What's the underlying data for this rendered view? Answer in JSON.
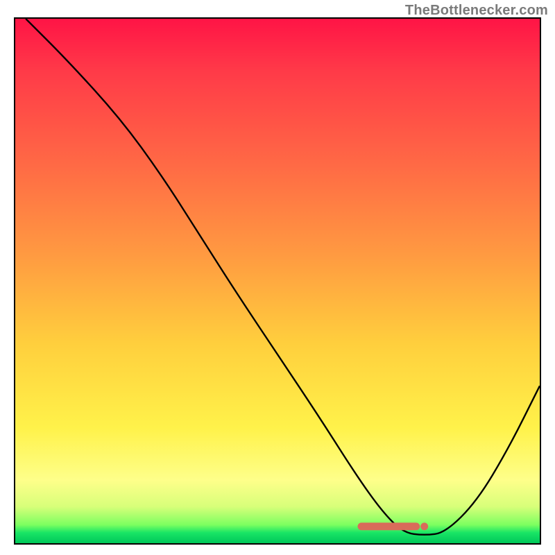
{
  "attribution": "TheBottlenecker.com",
  "chart_data": {
    "type": "line",
    "title": "",
    "xlabel": "",
    "ylabel": "",
    "xlim": [
      0,
      100
    ],
    "ylim": [
      0,
      100
    ],
    "x": [
      2,
      10,
      20,
      28,
      35,
      42,
      50,
      58,
      65,
      70,
      74,
      78,
      82,
      88,
      94,
      100
    ],
    "values": [
      100,
      92,
      81,
      70,
      59,
      48,
      36,
      24,
      13,
      6,
      2,
      1.5,
      2,
      8,
      18,
      30
    ],
    "marker": {
      "x_start": 66,
      "x_end": 78,
      "y": 3.2
    },
    "gradient_stops": [
      {
        "pos": 0,
        "color": "#ff1446"
      },
      {
        "pos": 0.28,
        "color": "#ff6a45"
      },
      {
        "pos": 0.62,
        "color": "#ffcf3d"
      },
      {
        "pos": 0.88,
        "color": "#feff8a"
      },
      {
        "pos": 0.97,
        "color": "#19e565"
      },
      {
        "pos": 1.0,
        "color": "#00c85a"
      }
    ]
  }
}
